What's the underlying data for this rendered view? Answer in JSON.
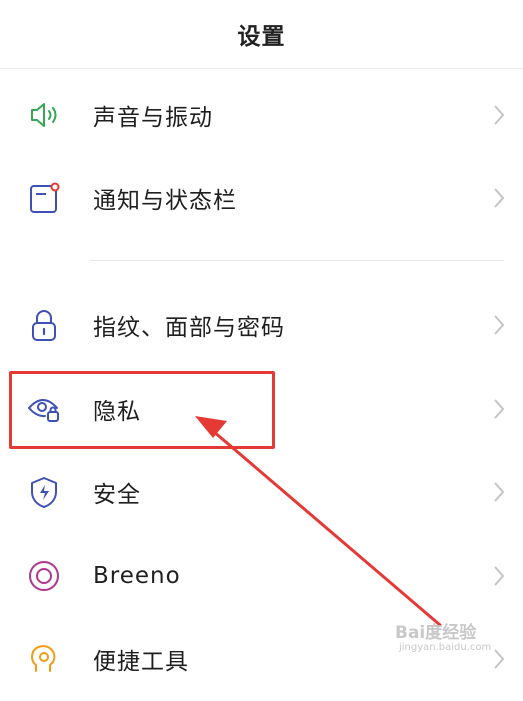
{
  "header": {
    "title": "设置"
  },
  "items": [
    {
      "label": "声音与振动",
      "icon": "speaker-icon",
      "color": "#34a853"
    },
    {
      "label": "通知与状态栏",
      "icon": "notification-icon",
      "color": "#3f51b5"
    },
    {
      "label": "指纹、面部与密码",
      "icon": "lock-icon",
      "color": "#3f51b5"
    },
    {
      "label": "隐私",
      "icon": "privacy-eye-icon",
      "color": "#3f51b5"
    },
    {
      "label": "安全",
      "icon": "shield-icon",
      "color": "#3f51b5"
    },
    {
      "label": "Breeno",
      "icon": "breeno-icon",
      "color": "#b0368f"
    },
    {
      "label": "便捷工具",
      "icon": "tools-icon",
      "color": "#f39c12"
    }
  ],
  "watermark": {
    "main": "Bai度经验",
    "sub": "jingyan.baidu.com"
  },
  "colors": {
    "highlight": "#e53935",
    "chevron": "#c4c4c4"
  }
}
